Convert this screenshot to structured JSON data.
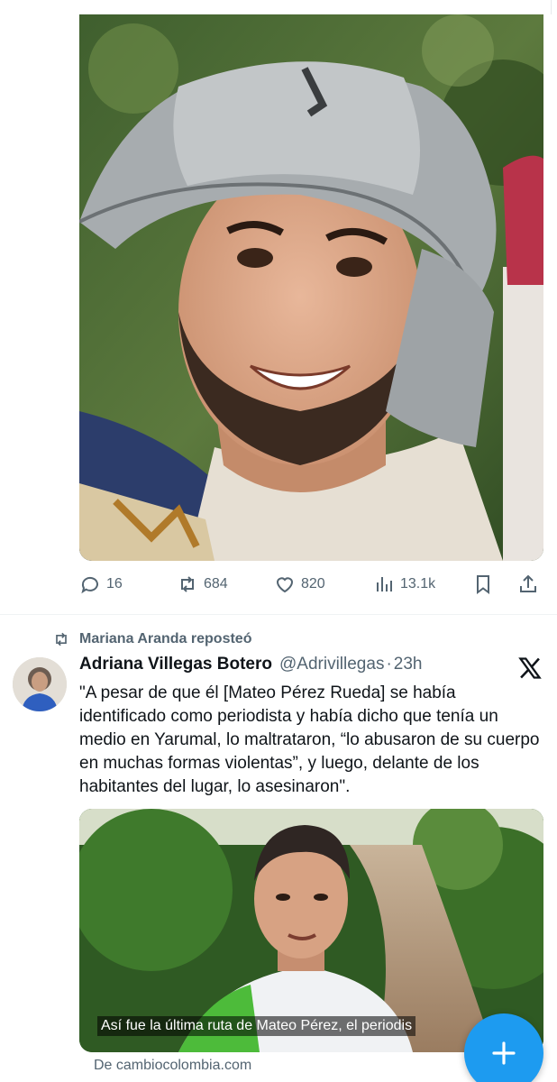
{
  "tweet1": {
    "stats": {
      "replies": "16",
      "reposts": "684",
      "likes": "820",
      "views": "13.1k"
    }
  },
  "tweet2": {
    "repost_label": "Mariana Aranda reposteó",
    "author_name": "Adriana Villegas Botero",
    "handle": "@Adrivillegas",
    "separator": "·",
    "time": "23h",
    "text": "\"A pesar de que él [Mateo Pérez Rueda] se había identificado como periodista y había dicho que tenía un medio en Yarumal, lo maltrataron, “lo abusaron de su cuerpo en muchas formas violentas”, y luego, delante de los habitantes del lugar, lo asesinaron\".",
    "card_caption": "Así fue la última ruta de Mateo Pérez, el periodis",
    "source": "De cambiocolombia.com"
  },
  "icons": {
    "reply": "speech-bubble-icon",
    "repost": "repost-arrows-icon",
    "like": "heart-icon",
    "views": "bar-chart-icon",
    "bookmark": "bookmark-icon",
    "share": "share-upload-icon",
    "platform": "x-logo-icon",
    "compose": "plus-icon"
  },
  "colors": {
    "accent": "#1d9bf0",
    "text_primary": "#0f1419",
    "text_secondary": "#536471"
  }
}
